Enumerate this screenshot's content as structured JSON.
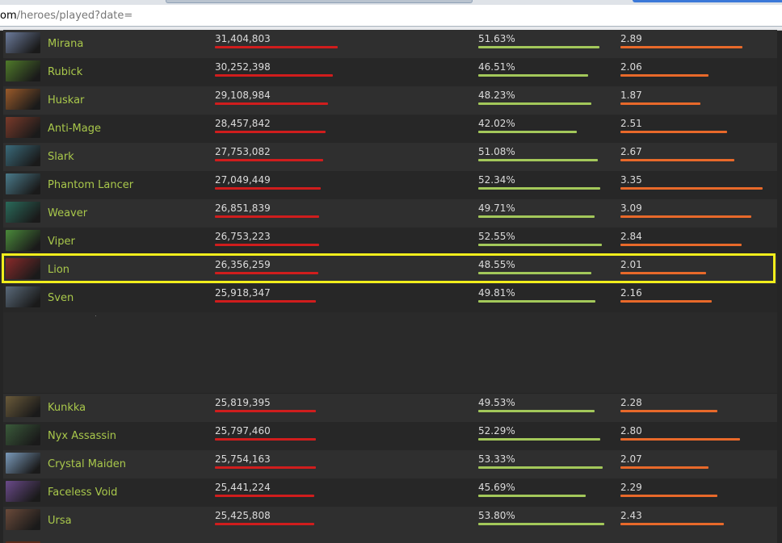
{
  "browser": {
    "url_domain": "om",
    "url_path": "/heroes/played?date="
  },
  "colors": {
    "hero_name": "#a9c84b",
    "played_bar": "#d01d1d",
    "winrate_bar": "#a3c85a",
    "kda_bar": "#e8692a",
    "highlight_border": "#f2ee1c"
  },
  "rows": [
    {
      "hero": "Mirana",
      "icon": "mirana-portrait-icon",
      "tone": "#6b7a9a",
      "played": "31,404,803",
      "played_bar": 1.0,
      "winrate": "51.63%",
      "winrate_bar": 0.96,
      "kda": "2.89",
      "kda_bar": 0.86
    },
    {
      "hero": "Rubick",
      "icon": "rubick-portrait-icon",
      "tone": "#4f7a2a",
      "played": "30,252,398",
      "played_bar": 0.96,
      "winrate": "46.51%",
      "winrate_bar": 0.87,
      "kda": "2.06",
      "kda_bar": 0.62
    },
    {
      "hero": "Huskar",
      "icon": "huskar-portrait-icon",
      "tone": "#9a5a2a",
      "played": "29,108,984",
      "played_bar": 0.92,
      "winrate": "48.23%",
      "winrate_bar": 0.9,
      "kda": "1.87",
      "kda_bar": 0.56
    },
    {
      "hero": "Anti-Mage",
      "icon": "anti-mage-portrait-icon",
      "tone": "#7a3a2a",
      "played": "28,457,842",
      "played_bar": 0.9,
      "winrate": "42.02%",
      "winrate_bar": 0.78,
      "kda": "2.51",
      "kda_bar": 0.75
    },
    {
      "hero": "Slark",
      "icon": "slark-portrait-icon",
      "tone": "#3a6a7a",
      "played": "27,753,082",
      "played_bar": 0.88,
      "winrate": "51.08%",
      "winrate_bar": 0.95,
      "kda": "2.67",
      "kda_bar": 0.8
    },
    {
      "hero": "Phantom Lancer",
      "icon": "phantom-lancer-portrait-icon",
      "tone": "#4a7a8a",
      "played": "27,049,449",
      "played_bar": 0.86,
      "winrate": "52.34%",
      "winrate_bar": 0.97,
      "kda": "3.35",
      "kda_bar": 1.0
    },
    {
      "hero": "Weaver",
      "icon": "weaver-portrait-icon",
      "tone": "#2a6a5a",
      "played": "26,851,839",
      "played_bar": 0.85,
      "winrate": "49.71%",
      "winrate_bar": 0.92,
      "kda": "3.09",
      "kda_bar": 0.92
    },
    {
      "hero": "Viper",
      "icon": "viper-portrait-icon",
      "tone": "#4a8a3a",
      "played": "26,753,223",
      "played_bar": 0.85,
      "winrate": "52.55%",
      "winrate_bar": 0.98,
      "kda": "2.84",
      "kda_bar": 0.85
    },
    {
      "hero": "Lion",
      "icon": "lion-portrait-icon",
      "tone": "#8a2a2a",
      "played": "26,356,259",
      "played_bar": 0.84,
      "winrate": "48.55%",
      "winrate_bar": 0.9,
      "kda": "2.01",
      "kda_bar": 0.6
    },
    {
      "hero": "Sven",
      "icon": "sven-portrait-icon",
      "tone": "#5a6a7a",
      "played": "25,918,347",
      "played_bar": 0.82,
      "winrate": "49.81%",
      "winrate_bar": 0.93,
      "kda": "2.16",
      "kda_bar": 0.64
    },
    {
      "hero": "Kunkka",
      "icon": "kunkka-portrait-icon",
      "tone": "#6a5a3a",
      "played": "25,819,395",
      "played_bar": 0.82,
      "winrate": "49.53%",
      "winrate_bar": 0.92,
      "kda": "2.28",
      "kda_bar": 0.68
    },
    {
      "hero": "Nyx Assassin",
      "icon": "nyx-assassin-portrait-icon",
      "tone": "#3a5a3a",
      "played": "25,797,460",
      "played_bar": 0.82,
      "winrate": "52.29%",
      "winrate_bar": 0.97,
      "kda": "2.80",
      "kda_bar": 0.84
    },
    {
      "hero": "Crystal Maiden",
      "icon": "crystal-maiden-portrait-icon",
      "tone": "#7a9aba",
      "played": "25,754,163",
      "played_bar": 0.82,
      "winrate": "53.33%",
      "winrate_bar": 0.99,
      "kda": "2.07",
      "kda_bar": 0.62
    },
    {
      "hero": "Faceless Void",
      "icon": "faceless-void-portrait-icon",
      "tone": "#6a4a8a",
      "played": "25,441,224",
      "played_bar": 0.81,
      "winrate": "45.69%",
      "winrate_bar": 0.85,
      "kda": "2.29",
      "kda_bar": 0.68
    },
    {
      "hero": "Ursa",
      "icon": "ursa-portrait-icon",
      "tone": "#6a4a3a",
      "played": "25,425,808",
      "played_bar": 0.81,
      "winrate": "53.80%",
      "winrate_bar": 1.0,
      "kda": "2.43",
      "kda_bar": 0.73
    }
  ]
}
